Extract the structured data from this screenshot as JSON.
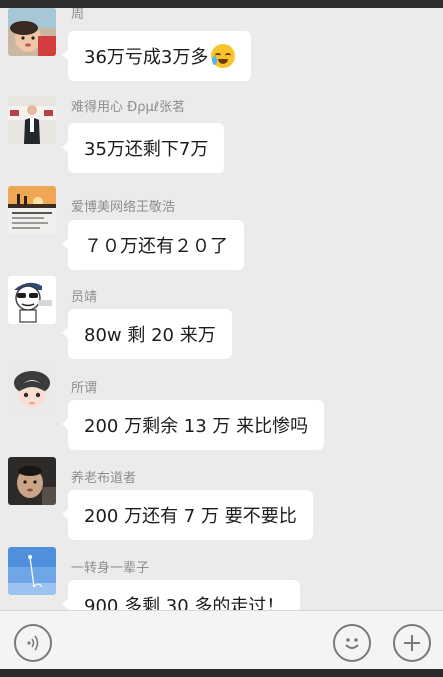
{
  "messages": [
    {
      "sender": "周",
      "text": "36万亏成3万多",
      "emoji": "crying-laughing-emoji",
      "avatar": "baby-photo"
    },
    {
      "sender": "难得用心 Ɖρμℓ张茗",
      "text": "35万还剩下7万",
      "emoji": null,
      "avatar": "office-man-photo"
    },
    {
      "sender": "爱博美网络王敬浩",
      "text": "７０万还有２０了",
      "emoji": null,
      "avatar": "sunset-quote-photo"
    },
    {
      "sender": "员靖",
      "text": "80w 剩 20 来万",
      "emoji": null,
      "avatar": "cartoon-sunglasses"
    },
    {
      "sender": "所谓",
      "text": "200 万剩余 13 万  来比惨吗",
      "emoji": null,
      "avatar": "anime-boy"
    },
    {
      "sender": "养老布道者",
      "text": "200 万还有 7 万 要不要比",
      "emoji": null,
      "avatar": "baby-dark-photo"
    },
    {
      "sender": "一转身一辈子",
      "text": "900 多剩 30 多的走过！",
      "emoji": null,
      "avatar": "sky-photo"
    }
  ],
  "input_bar": {
    "voice_icon": "voice-icon",
    "emoji_icon": "emoji-icon",
    "plus_icon": "plus-icon"
  }
}
